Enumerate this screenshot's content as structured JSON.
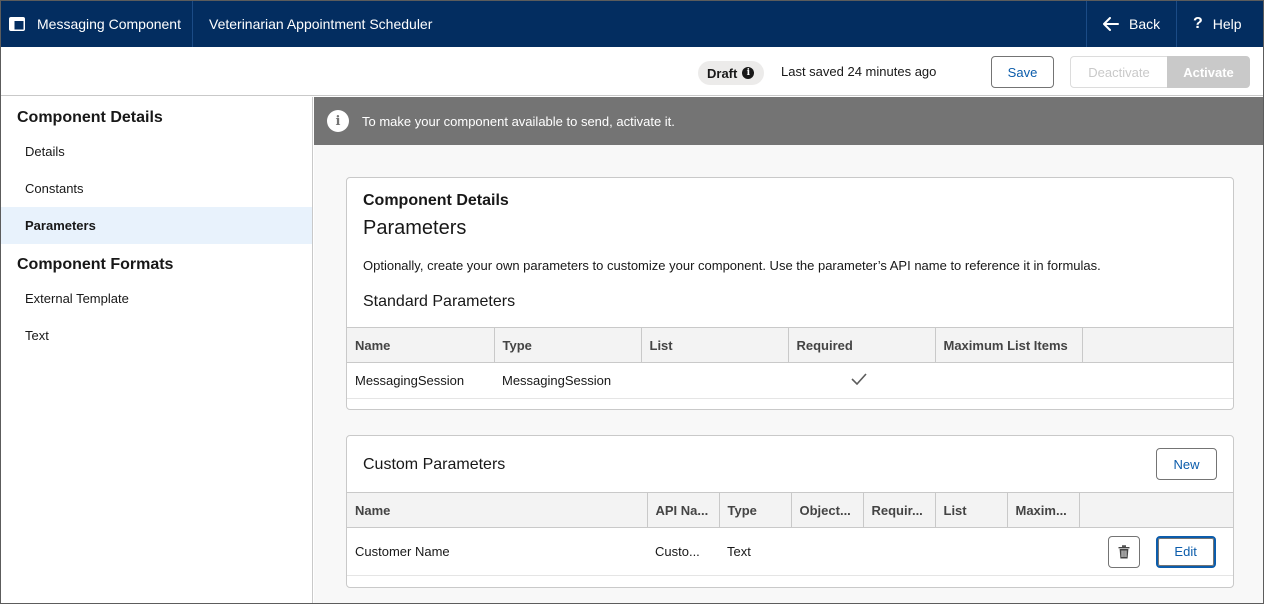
{
  "topbar": {
    "app_title": "Messaging Component",
    "record_title": "Veterinarian Appointment Scheduler",
    "back_label": "Back",
    "help_label": "Help"
  },
  "toolbar": {
    "status_badge": "Draft",
    "last_saved": "Last saved 24 minutes ago",
    "save_label": "Save",
    "deactivate_label": "Deactivate",
    "activate_label": "Activate"
  },
  "sidebar": {
    "section1": "Component Details",
    "items1": [
      {
        "label": "Details"
      },
      {
        "label": "Constants"
      },
      {
        "label": "Parameters",
        "active": true
      }
    ],
    "section2": "Component Formats",
    "items2": [
      {
        "label": "External Template"
      },
      {
        "label": "Text"
      }
    ]
  },
  "banner": {
    "text": "To make your component available to send, activate it."
  },
  "standard_card": {
    "eyebrow": "Component Details",
    "title": "Parameters",
    "description": "Optionally, create your own parameters to customize your component. Use the parameter’s API name to reference it in formulas.",
    "subtitle": "Standard Parameters",
    "columns": [
      "Name",
      "Type",
      "List",
      "Required",
      "Maximum List Items"
    ],
    "rows": [
      {
        "name": "MessagingSession",
        "type": "MessagingSession",
        "list": "",
        "required": true,
        "max": ""
      }
    ]
  },
  "custom_card": {
    "title": "Custom Parameters",
    "new_label": "New",
    "columns": [
      "Name",
      "API Na...",
      "Type",
      "Object...",
      "Requir...",
      "List",
      "Maxim..."
    ],
    "rows": [
      {
        "name": "Customer Name",
        "api_name": "Custo...",
        "type": "Text",
        "object": "",
        "required": "",
        "list": "",
        "max": "",
        "edit_label": "Edit"
      }
    ]
  },
  "colors": {
    "header_bg": "#032d60",
    "brand_blue": "#0b5cab",
    "banner_bg": "#747474",
    "active_nav_bg": "#e8f2fc"
  },
  "icons": {
    "app": "app-window-icon",
    "back": "arrow-left-icon",
    "help": "question-icon",
    "info": "info-icon",
    "check": "checkmark-icon",
    "delete": "trash-icon"
  }
}
